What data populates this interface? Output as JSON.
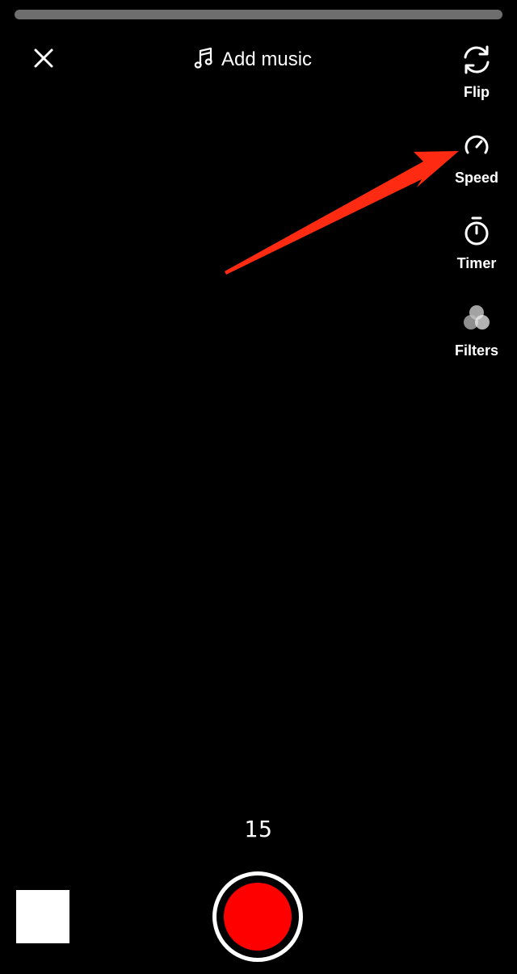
{
  "top_progress": {
    "fraction": 0
  },
  "top_bar": {
    "close_icon": "close-icon",
    "add_music": {
      "icon": "music-note-icon",
      "label": "Add music"
    }
  },
  "side_tools": [
    {
      "id": "flip",
      "label": "Flip",
      "icon": "flip-camera-icon"
    },
    {
      "id": "speed",
      "label": "Speed",
      "icon": "speedometer-icon"
    },
    {
      "id": "timer",
      "label": "Timer",
      "icon": "stopwatch-icon"
    },
    {
      "id": "filters",
      "label": "Filters",
      "icon": "filters-icon"
    }
  ],
  "annotation": {
    "type": "arrow",
    "color": "#ff2a12",
    "points_to": "speed"
  },
  "bottom_bar": {
    "duration": "15",
    "record_color": "#ff0000",
    "gallery_thumb_color": "#ffffff"
  }
}
